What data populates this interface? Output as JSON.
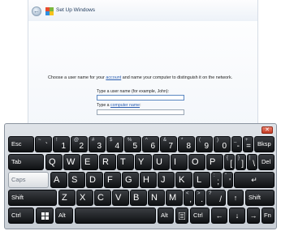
{
  "window": {
    "title": "Set Up Windows",
    "back_symbol": "←",
    "instruction_pre": "Choose a user name for your ",
    "instruction_link": "account",
    "instruction_post": " and name your computer to distinguish it on the network.",
    "username_label": "Type a user name (for example, John):",
    "username_value": "",
    "computer_label_pre": "Type a ",
    "computer_label_link": "computer name",
    "computer_label_post": ":",
    "computer_value": ""
  },
  "keyboard": {
    "close_symbol": "✕",
    "row1": {
      "esc": "Esc",
      "pairs": [
        {
          "shift": "~",
          "base": "`"
        },
        {
          "shift": "!",
          "base": "1"
        },
        {
          "shift": "@",
          "base": "2"
        },
        {
          "shift": "#",
          "base": "3"
        },
        {
          "shift": "$",
          "base": "4"
        },
        {
          "shift": "%",
          "base": "5"
        },
        {
          "shift": "^",
          "base": "6"
        },
        {
          "shift": "&",
          "base": "7"
        },
        {
          "shift": "*",
          "base": "8"
        },
        {
          "shift": "(",
          "base": "9"
        },
        {
          "shift": ")",
          "base": "0"
        },
        {
          "shift": "_",
          "base": "-"
        },
        {
          "shift": "+",
          "base": "="
        }
      ],
      "bksp": "Bksp"
    },
    "row2": {
      "tab": "Tab",
      "letters": [
        "Q",
        "W",
        "E",
        "R",
        "T",
        "Y",
        "U",
        "I",
        "O",
        "P"
      ],
      "pairs": [
        {
          "shift": "{",
          "base": "["
        },
        {
          "shift": "}",
          "base": "]"
        },
        {
          "shift": "|",
          "base": "\\"
        }
      ],
      "del": "Del"
    },
    "row3": {
      "caps": "Caps",
      "letters": [
        "A",
        "S",
        "D",
        "F",
        "G",
        "H",
        "J",
        "K",
        "L"
      ],
      "pairs": [
        {
          "shift": ":",
          "base": ";"
        },
        {
          "shift": "\"",
          "base": "'"
        }
      ],
      "enter_symbol": "↵"
    },
    "row4": {
      "shift_left": "Shift",
      "letters": [
        "Z",
        "X",
        "C",
        "V",
        "B",
        "N",
        "M"
      ],
      "pairs": [
        {
          "shift": "<",
          "base": ","
        },
        {
          "shift": ">",
          "base": "."
        },
        {
          "shift": "?",
          "base": "/"
        }
      ],
      "up_symbol": "↑",
      "shift_right": "Shift"
    },
    "row5": {
      "ctrl_left": "Ctrl",
      "win_icon": "windows-icon",
      "alt_left": "Alt",
      "alt_right": "Alt",
      "menu_icon": "menu-icon",
      "ctrl_right": "Ctrl",
      "left_symbol": "←",
      "down_symbol": "↓",
      "right_symbol": "→",
      "fn": "Fn"
    }
  }
}
